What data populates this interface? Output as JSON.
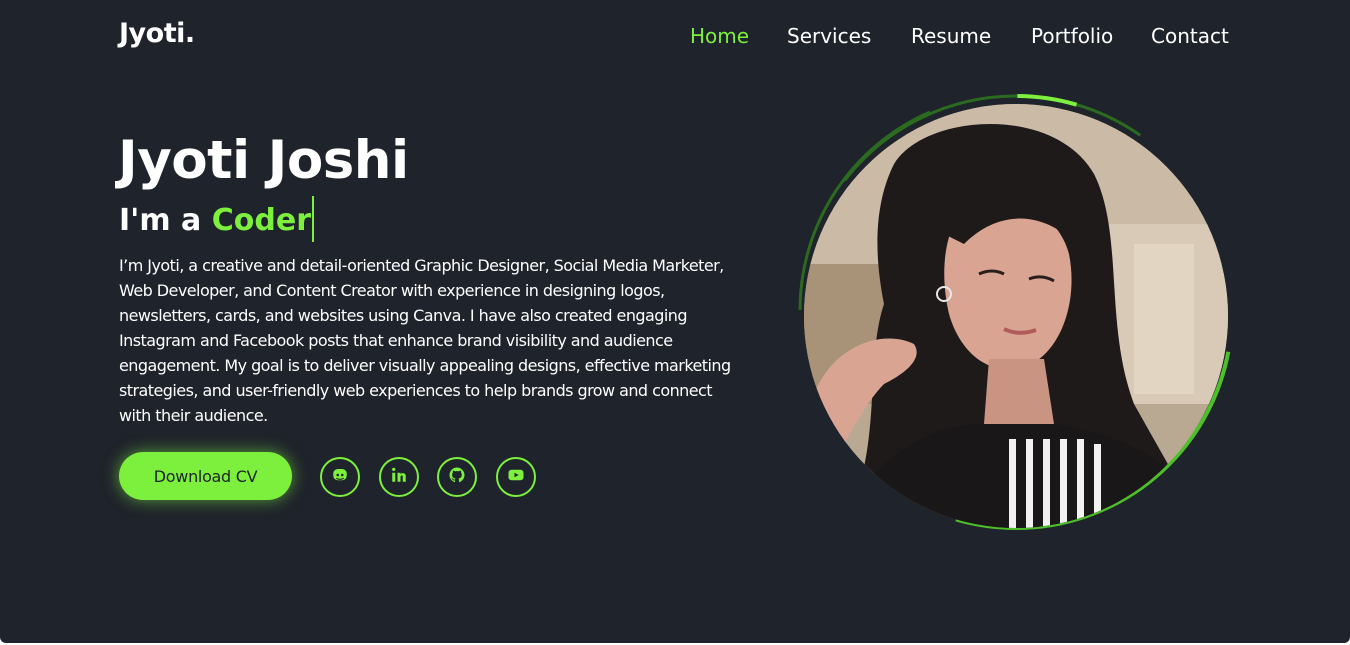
{
  "brand": {
    "logo": "Jyoti."
  },
  "nav": {
    "items": [
      {
        "label": "Home",
        "active": true
      },
      {
        "label": "Services",
        "active": false
      },
      {
        "label": "Resume",
        "active": false
      },
      {
        "label": "Portfolio",
        "active": false
      },
      {
        "label": "Contact",
        "active": false
      }
    ]
  },
  "hero": {
    "name": "Jyoti Joshi",
    "role_prefix": "I'm a",
    "role_highlight": "Coder",
    "bio": "I’m Jyoti, a creative and detail-oriented Graphic Designer, Social Media Marketer, Web Developer, and Content Creator with experience in designing logos, newsletters, cards, and websites using Canva. I have also created engaging Instagram and Facebook posts that enhance brand visibility and audience engagement. My goal is to deliver visually appealing designs, effective marketing strategies, and user-friendly web experiences to help brands grow and connect with their audience.",
    "cv_button": "Download CV"
  },
  "social": [
    {
      "icon": "discord-icon"
    },
    {
      "icon": "linkedin-icon"
    },
    {
      "icon": "github-icon"
    },
    {
      "icon": "youtube-icon"
    }
  ],
  "colors": {
    "accent": "#7cf03d",
    "background": "#1f232b",
    "text": "#ffffff",
    "ring_dark": "#2b6b1f"
  }
}
